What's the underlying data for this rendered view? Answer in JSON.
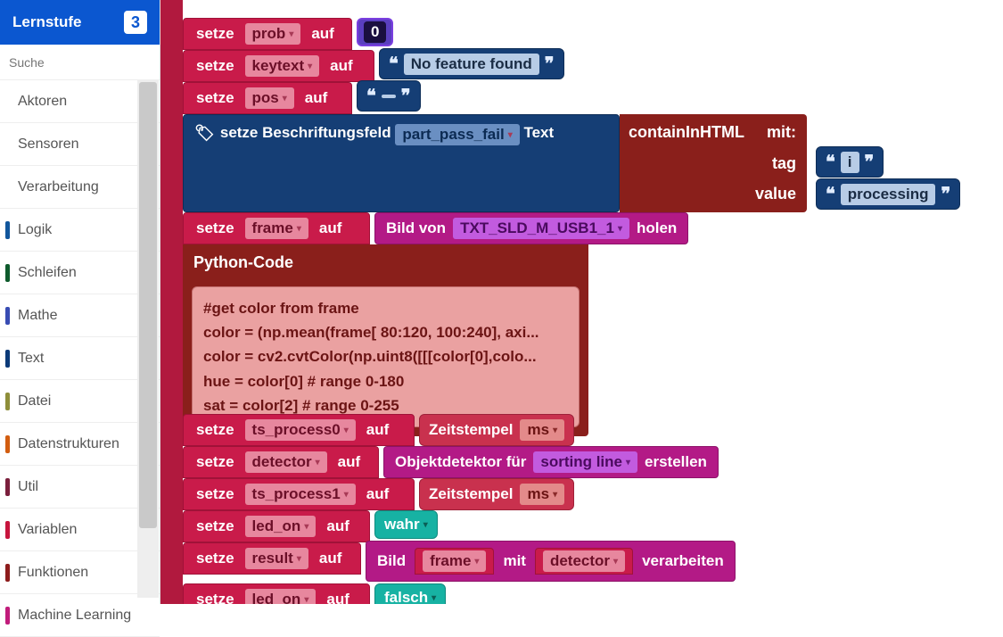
{
  "sidebar": {
    "title": "Lernstufe",
    "level": "3",
    "search_placeholder": "Suche",
    "cats_top": [
      {
        "label": "Aktoren",
        "arrow": "▾"
      },
      {
        "label": "Sensoren",
        "arrow": "▾"
      },
      {
        "label": "Verarbeitung",
        "arrow": "▴"
      }
    ],
    "cats_color": [
      {
        "label": "Logik",
        "cls": "c-logik"
      },
      {
        "label": "Schleifen",
        "cls": "c-schleifen"
      },
      {
        "label": "Mathe",
        "cls": "c-mathe"
      },
      {
        "label": "Text",
        "cls": "c-text"
      },
      {
        "label": "Datei",
        "cls": "c-datei"
      },
      {
        "label": "Datenstrukturen",
        "cls": "c-daten"
      },
      {
        "label": "Util",
        "cls": "c-util"
      },
      {
        "label": "Variablen",
        "cls": "c-var"
      },
      {
        "label": "Funktionen",
        "cls": "c-funk"
      },
      {
        "label": "Machine Learning",
        "cls": "c-ml"
      }
    ]
  },
  "w": {
    "setze": "setze",
    "auf": "auf",
    "holen": "holen",
    "mit": "mit",
    "erstellen": "erstellen",
    "verarbeiten": "verarbeiten"
  },
  "vars": {
    "prob": "prob",
    "keytext": "keytext",
    "pos": "pos",
    "frame": "frame",
    "ts0": "ts_process0",
    "detector": "detector",
    "ts1": "ts_process1",
    "led": "led_on",
    "result": "result"
  },
  "vals": {
    "zero": "0",
    "nofeature": "No feature found",
    "empty": " ",
    "i": "i",
    "processing": "processing",
    "camera": "TXT_SLD_M_USB1_1",
    "ms": "ms",
    "sorting": "sorting line",
    "wahr": "wahr",
    "falsch": "falsch"
  },
  "label": {
    "setzeLabel": "setze Beschriftungsfeld",
    "part": "part_pass_fail",
    "text": "Text",
    "contain": "containInHTML",
    "mitcolon": "mit:",
    "tag": "tag",
    "value": "value",
    "bildvon": "Bild von",
    "pycode": "Python-Code",
    "zeitstempel": "Zeitstempel",
    "objdet": "Objektdetektor für",
    "bild": "Bild",
    "mit": "mit"
  },
  "python": {
    "l1": "#get color from frame",
    "l2": "color = (np.mean(frame[ 80:120,  100:240], axi...",
    "l3": "color = cv2.cvtColor(np.uint8([[[color[0],colo...",
    "l4": "hue = color[0] # range 0-180",
    "l5": "sat = color[2] # range 0-255"
  }
}
